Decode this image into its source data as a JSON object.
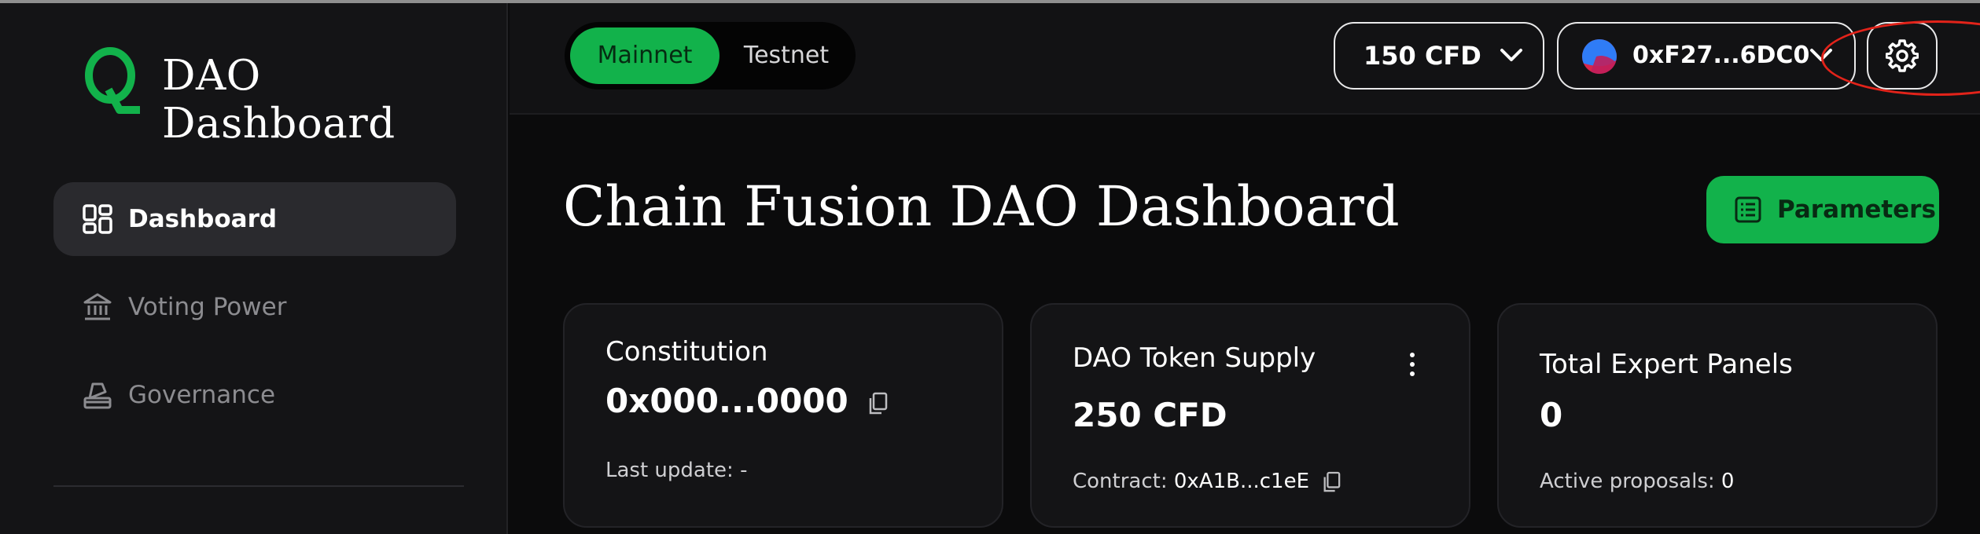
{
  "brand": {
    "logo_letter": "Q",
    "title": "DAO Dashboard",
    "accent": "#12b24b"
  },
  "sidebar": {
    "items": [
      {
        "label": "Dashboard",
        "icon": "dashboard-grid-icon",
        "active": true
      },
      {
        "label": "Voting Power",
        "icon": "bank-icon",
        "active": false
      },
      {
        "label": "Governance",
        "icon": "vote-box-icon",
        "active": false
      }
    ]
  },
  "header": {
    "network": {
      "options": [
        "Mainnet",
        "Testnet"
      ],
      "selected": "Mainnet"
    },
    "balance": {
      "label": "150 CFD",
      "icon": "chevron-down-icon"
    },
    "wallet": {
      "address": "0xF27...6DC0",
      "icon": "chevron-down-icon"
    },
    "settings": {
      "icon": "gear-icon"
    }
  },
  "main": {
    "title": "Chain Fusion DAO Dashboard",
    "parameters_button": {
      "label": "Parameters",
      "icon": "list-icon"
    },
    "cards": [
      {
        "title": "Constitution",
        "value": "0x000...0000",
        "sub_label": "Last update:",
        "sub_value": "-"
      },
      {
        "title": "DAO Token Supply",
        "value": "250 CFD",
        "sub_label": "Contract:",
        "sub_value": "0xA1B...c1eE"
      },
      {
        "title": "Total Expert Panels",
        "value": "0",
        "sub_label": "Active proposals:",
        "sub_value": "0"
      }
    ]
  },
  "annotation": {
    "color": "#e2231a"
  }
}
